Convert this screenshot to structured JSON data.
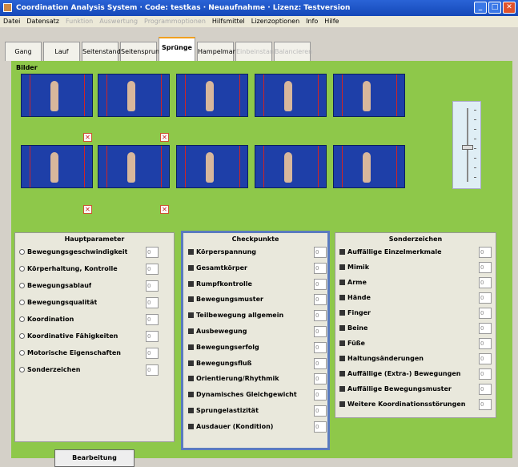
{
  "window": {
    "title": "Coordination Analysis System · Code: testkas · Neuaufnahme · Lizenz: Testversion",
    "buttons": [
      "_",
      "□",
      "✕"
    ]
  },
  "menu": [
    {
      "label": "Datei",
      "disabled": false
    },
    {
      "label": "Datensatz",
      "disabled": false
    },
    {
      "label": "Funktion",
      "disabled": true
    },
    {
      "label": "Auswertung",
      "disabled": true
    },
    {
      "label": "Programmoptionen",
      "disabled": true
    },
    {
      "label": "Hilfsmittel",
      "disabled": false
    },
    {
      "label": "Lizenzoptionen",
      "disabled": false
    },
    {
      "label": "Info",
      "disabled": false
    },
    {
      "label": "Hilfe",
      "disabled": false
    }
  ],
  "tabs": [
    {
      "label": "Gang",
      "active": false,
      "disabled": false
    },
    {
      "label": "Lauf",
      "active": false,
      "disabled": false
    },
    {
      "label": "Seitenstand",
      "active": false,
      "disabled": false
    },
    {
      "label": "Seitensprung",
      "active": false,
      "disabled": false
    },
    {
      "label": "Sprünge",
      "active": true,
      "disabled": false
    },
    {
      "label": "Hampelmann",
      "active": false,
      "disabled": false
    },
    {
      "label": "Einbeinstand",
      "active": false,
      "disabled": true
    },
    {
      "label": "Balancieren",
      "active": false,
      "disabled": true
    }
  ],
  "bilder": {
    "label": "Bilder"
  },
  "hauptparameter": {
    "title": "Hauptparameter",
    "items": [
      {
        "label": "Bewegungsgeschwindigkeit",
        "value": "0"
      },
      {
        "label": "Körperhaltung, Kontrolle",
        "value": "0"
      },
      {
        "label": "Bewegungsablauf",
        "value": "0"
      },
      {
        "label": "Bewegungsqualität",
        "value": "0"
      },
      {
        "label": "Koordination",
        "value": "0"
      },
      {
        "label": "Koordinative Fähigkeiten",
        "value": "0"
      },
      {
        "label": "Motorische Eigenschaften",
        "value": "0"
      },
      {
        "label": "Sonderzeichen",
        "value": "0"
      }
    ],
    "button": "Bearbeitung"
  },
  "checkpunkte": {
    "title": "Checkpunkte",
    "items": [
      {
        "label": "Körperspannung",
        "value": "0"
      },
      {
        "label": "Gesamtkörper",
        "value": "0"
      },
      {
        "label": "Rumpfkontrolle",
        "value": "0"
      },
      {
        "label": "Bewegungsmuster",
        "value": "0"
      },
      {
        "label": "Teilbewegung allgemein",
        "value": "0"
      },
      {
        "label": "Ausbewegung",
        "value": "0"
      },
      {
        "label": "Bewegungserfolg",
        "value": "0"
      },
      {
        "label": "Bewegungsfluß",
        "value": "0"
      },
      {
        "label": "Orientierung/Rhythmik",
        "value": "0"
      },
      {
        "label": "Dynamisches Gleichgewicht",
        "value": "0"
      },
      {
        "label": "Sprungelastizität",
        "value": "0"
      },
      {
        "label": "Ausdauer (Kondition)",
        "value": "0"
      }
    ]
  },
  "sonderzeichen": {
    "title": "Sonderzeichen",
    "items": [
      {
        "label": "Auffällige Einzelmerkmale",
        "value": "0"
      },
      {
        "label": "Mimik",
        "value": "0"
      },
      {
        "label": "Arme",
        "value": "0"
      },
      {
        "label": "Hände",
        "value": "0"
      },
      {
        "label": "Finger",
        "value": "0"
      },
      {
        "label": "Beine",
        "value": "0"
      },
      {
        "label": "Füße",
        "value": "0"
      },
      {
        "label": "Haltungsänderungen",
        "value": "0"
      },
      {
        "label": "Auffällige (Extra-) Bewegungen",
        "value": "0"
      },
      {
        "label": "Auffällige Bewegungsmuster",
        "value": "0"
      },
      {
        "label": "Weitere Koordinationsstörungen",
        "value": "0"
      }
    ]
  },
  "colors": {
    "green": "#8ec84a",
    "blue": "#1e3fa8",
    "title": "#1448b8"
  }
}
